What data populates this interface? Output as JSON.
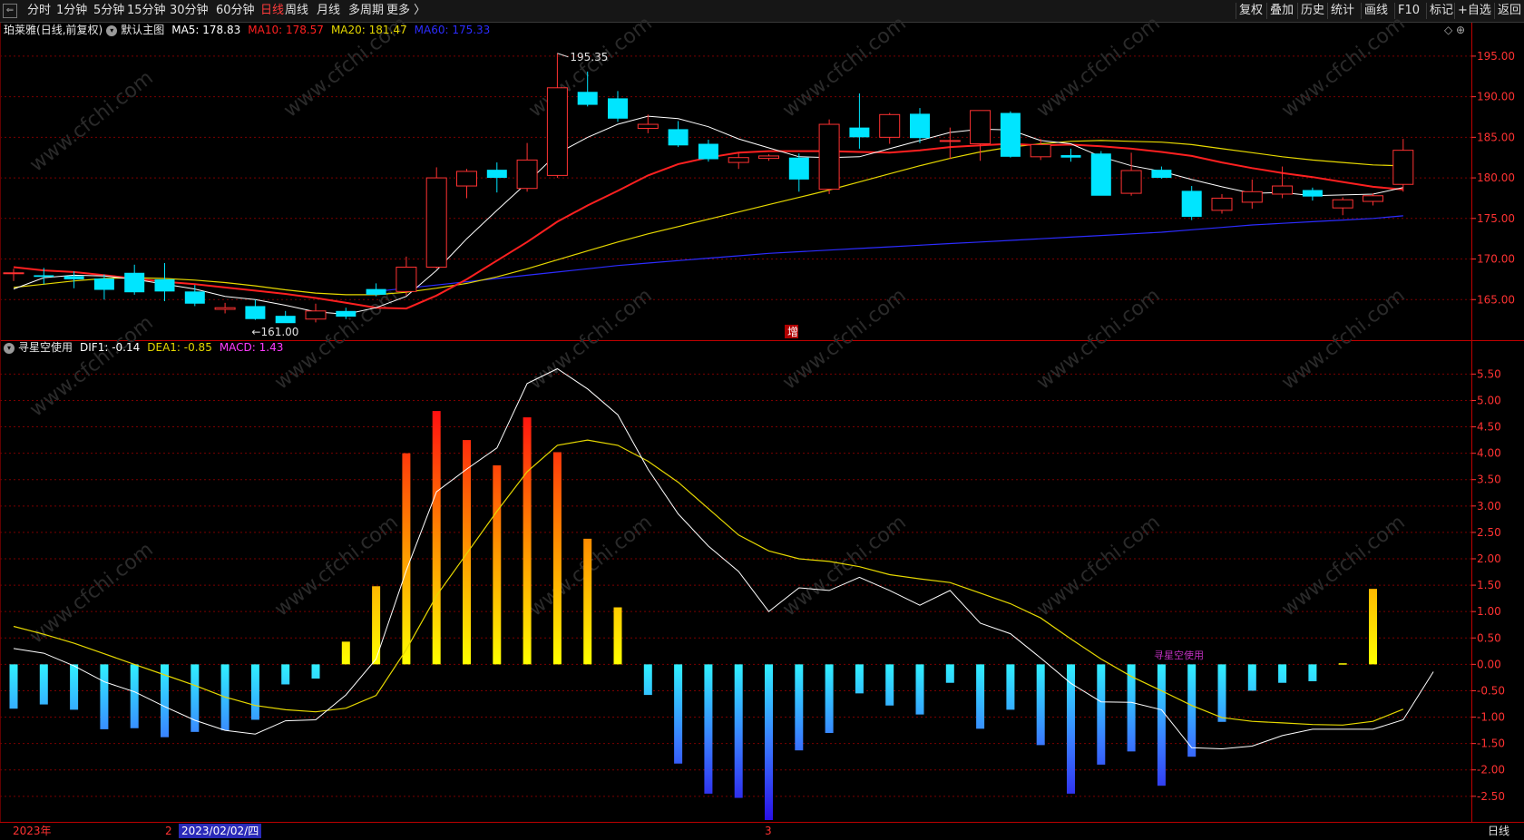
{
  "toolbar": {
    "back_glyph": "⇐",
    "timeframes": [
      {
        "label": "分时",
        "active": false
      },
      {
        "label": "1分钟",
        "active": false
      },
      {
        "label": "5分钟",
        "active": false
      },
      {
        "label": "15分钟",
        "active": false
      },
      {
        "label": "30分钟",
        "active": false
      },
      {
        "label": "60分钟",
        "active": false
      },
      {
        "label": "日线",
        "active": true
      },
      {
        "label": "周线",
        "active": false
      },
      {
        "label": "月线",
        "active": false
      },
      {
        "label": "多周期",
        "active": false
      },
      {
        "label": "更多 〉",
        "active": false
      }
    ],
    "right_buttons": [
      "复权",
      "叠加",
      "历史",
      "统计",
      "画线",
      "F10",
      "标记",
      "+自选",
      "返回"
    ]
  },
  "main_legend": {
    "name": "珀莱雅",
    "period": "(日线,前复权)",
    "template": "默认主图",
    "ma5": {
      "label": "MA5: 178.83",
      "color": "#ffffff"
    },
    "ma10": {
      "label": "MA10: 178.57",
      "color": "#ff2020"
    },
    "ma20": {
      "label": "MA20: 181.47",
      "color": "#e6d800"
    },
    "ma60": {
      "label": "MA60: 175.33",
      "color": "#2c2cff"
    }
  },
  "main_corner_icons": "◇ ⊕",
  "marker_zeng": "增",
  "main_axis": {
    "ticks": [
      "195.00",
      "190.00",
      "185.00",
      "180.00",
      "175.00",
      "170.00",
      "165.00"
    ],
    "min": 160.0,
    "max": 197.0
  },
  "annotations": {
    "high": "195.35",
    "low": "161.00"
  },
  "sub_legend": {
    "name": "寻星空使用",
    "dif": {
      "label": "DIF1: -0.14",
      "color": "#ffffff"
    },
    "dea": {
      "label": "DEA1: -0.85",
      "color": "#e6d800"
    },
    "macd": {
      "label": "MACD: 1.43",
      "color": "#ff3cff"
    }
  },
  "sub_axis": {
    "ticks": [
      "5.50",
      "5.00",
      "4.50",
      "4.00",
      "3.50",
      "3.00",
      "2.50",
      "2.00",
      "1.50",
      "1.00",
      "0.50",
      "0.00",
      "-0.50",
      "-1.00",
      "-1.50",
      "-2.00",
      "-2.50"
    ],
    "min": -2.95,
    "max": 5.85
  },
  "watermark_label": "寻星空使用",
  "watermark_site": "www.cfchi.com",
  "bottom": {
    "year": "2023年",
    "feb_mark": "2",
    "date": "2023/02/02/四",
    "mar_mark": "3",
    "period": "日线"
  },
  "colors": {
    "up": "#ff3232",
    "down": "#00e5ff",
    "grid": "#7a0000",
    "axis": "#ff3232"
  },
  "chart_data": {
    "type": "candlestick",
    "candles": [
      {
        "o": 168.2,
        "h": 168.8,
        "l": 167.3,
        "c": 168.3
      },
      {
        "o": 168.0,
        "h": 168.9,
        "l": 166.9,
        "c": 167.8
      },
      {
        "o": 167.9,
        "h": 168.5,
        "l": 166.4,
        "c": 167.5
      },
      {
        "o": 167.6,
        "h": 168.1,
        "l": 165.0,
        "c": 166.2
      },
      {
        "o": 168.3,
        "h": 169.3,
        "l": 165.6,
        "c": 165.9
      },
      {
        "o": 167.5,
        "h": 169.5,
        "l": 164.8,
        "c": 166.0
      },
      {
        "o": 166.0,
        "h": 166.8,
        "l": 164.2,
        "c": 164.5
      },
      {
        "o": 163.8,
        "h": 164.6,
        "l": 163.3,
        "c": 164.0
      },
      {
        "o": 164.2,
        "h": 165.0,
        "l": 162.5,
        "c": 162.6
      },
      {
        "o": 163.0,
        "h": 163.6,
        "l": 162.2,
        "c": 162.1
      },
      {
        "o": 162.6,
        "h": 164.5,
        "l": 162.2,
        "c": 163.6
      },
      {
        "o": 163.6,
        "h": 164.0,
        "l": 162.6,
        "c": 162.9
      },
      {
        "o": 166.3,
        "h": 167.0,
        "l": 165.4,
        "c": 165.6
      },
      {
        "o": 166.0,
        "h": 170.3,
        "l": 165.5,
        "c": 169.0
      },
      {
        "o": 169.0,
        "h": 181.3,
        "l": 168.8,
        "c": 180.0
      },
      {
        "o": 179.0,
        "h": 181.1,
        "l": 177.5,
        "c": 180.8
      },
      {
        "o": 181.0,
        "h": 181.9,
        "l": 178.2,
        "c": 180.0
      },
      {
        "o": 178.7,
        "h": 184.3,
        "l": 178.3,
        "c": 182.2
      },
      {
        "o": 180.3,
        "h": 195.35,
        "l": 180.0,
        "c": 191.1
      },
      {
        "o": 190.6,
        "h": 193.1,
        "l": 188.8,
        "c": 189.0
      },
      {
        "o": 189.8,
        "h": 190.7,
        "l": 186.9,
        "c": 187.3
      },
      {
        "o": 186.1,
        "h": 187.8,
        "l": 185.5,
        "c": 186.6
      },
      {
        "o": 186.0,
        "h": 187.0,
        "l": 183.8,
        "c": 184.0
      },
      {
        "o": 184.2,
        "h": 184.7,
        "l": 182.0,
        "c": 182.3
      },
      {
        "o": 181.9,
        "h": 183.1,
        "l": 181.1,
        "c": 182.5
      },
      {
        "o": 182.4,
        "h": 182.9,
        "l": 182.1,
        "c": 182.7
      },
      {
        "o": 182.5,
        "h": 183.0,
        "l": 178.3,
        "c": 179.8
      },
      {
        "o": 178.6,
        "h": 187.2,
        "l": 178.0,
        "c": 186.6
      },
      {
        "o": 186.2,
        "h": 190.4,
        "l": 183.6,
        "c": 185.0
      },
      {
        "o": 185.0,
        "h": 188.0,
        "l": 184.2,
        "c": 187.8
      },
      {
        "o": 187.9,
        "h": 188.6,
        "l": 184.3,
        "c": 184.9
      },
      {
        "o": 184.5,
        "h": 186.2,
        "l": 182.3,
        "c": 184.6
      },
      {
        "o": 184.2,
        "h": 188.3,
        "l": 182.1,
        "c": 188.3
      },
      {
        "o": 188.0,
        "h": 188.2,
        "l": 182.5,
        "c": 182.6
      },
      {
        "o": 182.6,
        "h": 184.8,
        "l": 182.2,
        "c": 184.1
      },
      {
        "o": 182.8,
        "h": 183.6,
        "l": 182.0,
        "c": 182.5
      },
      {
        "o": 183.0,
        "h": 183.3,
        "l": 179.0,
        "c": 177.8
      },
      {
        "o": 178.1,
        "h": 183.1,
        "l": 177.8,
        "c": 180.9
      },
      {
        "o": 181.0,
        "h": 181.4,
        "l": 179.9,
        "c": 180.0
      },
      {
        "o": 178.4,
        "h": 179.0,
        "l": 174.8,
        "c": 175.2
      },
      {
        "o": 176.0,
        "h": 178.0,
        "l": 175.6,
        "c": 177.5
      },
      {
        "o": 177.0,
        "h": 179.8,
        "l": 176.2,
        "c": 178.3
      },
      {
        "o": 178.0,
        "h": 181.4,
        "l": 177.5,
        "c": 179.0
      },
      {
        "o": 178.5,
        "h": 178.8,
        "l": 177.2,
        "c": 177.7
      },
      {
        "o": 176.3,
        "h": 177.6,
        "l": 175.4,
        "c": 177.3
      },
      {
        "o": 177.1,
        "h": 178.1,
        "l": 176.6,
        "c": 177.8
      },
      {
        "o": 179.2,
        "h": 184.8,
        "l": 178.3,
        "c": 183.4
      }
    ],
    "ma5": [
      166.3,
      167.7,
      168.0,
      167.9,
      167.5,
      166.9,
      166.3,
      165.4,
      165.0,
      164.3,
      163.5,
      163.2,
      164.0,
      165.4,
      168.6,
      172.5,
      176.0,
      179.4,
      183.0,
      185.0,
      186.6,
      187.6,
      187.3,
      186.3,
      184.8,
      183.7,
      182.6,
      182.5,
      182.6,
      183.6,
      184.6,
      185.6,
      186.0,
      185.9,
      184.6,
      184.2,
      182.6,
      181.5,
      180.8,
      179.8,
      178.9,
      178.1,
      178.2,
      177.8,
      177.9,
      178.0,
      178.8
    ],
    "ma10": [
      169.0,
      168.6,
      168.4,
      168.0,
      167.6,
      167.2,
      166.9,
      166.5,
      166.1,
      165.7,
      165.2,
      164.6,
      164.0,
      163.9,
      165.5,
      167.5,
      169.8,
      172.1,
      174.6,
      176.6,
      178.4,
      180.3,
      181.7,
      182.5,
      183.1,
      183.3,
      183.3,
      183.3,
      183.2,
      183.1,
      183.4,
      183.8,
      184.0,
      184.2,
      184.0,
      184.1,
      183.9,
      183.6,
      183.2,
      182.7,
      181.9,
      181.2,
      180.6,
      180.1,
      179.5,
      178.9,
      178.57
    ],
    "ma20": [
      166.5,
      166.9,
      167.3,
      167.6,
      167.7,
      167.6,
      167.4,
      167.1,
      166.7,
      166.2,
      165.8,
      165.6,
      165.6,
      165.9,
      166.4,
      167.0,
      167.8,
      168.8,
      169.9,
      171.0,
      172.1,
      173.1,
      174.0,
      174.9,
      175.8,
      176.7,
      177.6,
      178.5,
      179.5,
      180.5,
      181.5,
      182.4,
      183.2,
      183.8,
      184.2,
      184.5,
      184.6,
      184.5,
      184.4,
      184.1,
      183.6,
      183.1,
      182.6,
      182.2,
      181.9,
      181.6,
      181.47
    ],
    "ma60": [
      null,
      null,
      null,
      null,
      null,
      null,
      null,
      null,
      null,
      null,
      null,
      null,
      166.0,
      166.4,
      166.8,
      167.2,
      167.6,
      168.0,
      168.4,
      168.8,
      169.2,
      169.5,
      169.8,
      170.1,
      170.4,
      170.7,
      170.9,
      171.1,
      171.3,
      171.5,
      171.7,
      171.9,
      172.1,
      172.3,
      172.5,
      172.7,
      172.9,
      173.1,
      173.3,
      173.6,
      173.9,
      174.2,
      174.4,
      174.6,
      174.8,
      175.0,
      175.33
    ],
    "dif": [
      0.3,
      0.21,
      -0.03,
      -0.33,
      -0.52,
      -0.8,
      -1.06,
      -1.25,
      -1.32,
      -1.07,
      -1.05,
      -0.58,
      0.1,
      1.78,
      3.27,
      3.7,
      4.1,
      5.32,
      5.6,
      5.22,
      4.73,
      3.7,
      2.85,
      2.24,
      1.76,
      1.0,
      1.45,
      1.4,
      1.65,
      1.4,
      1.12,
      1.4,
      0.78,
      0.58,
      0.12,
      -0.36,
      -0.71,
      -0.72,
      -0.86,
      -1.58,
      -1.6,
      -1.55,
      -1.35,
      -1.23,
      -1.23,
      -1.23,
      -1.05,
      -0.14
    ],
    "dea": [
      0.72,
      0.57,
      0.4,
      0.2,
      0.0,
      -0.2,
      -0.4,
      -0.62,
      -0.78,
      -0.86,
      -0.9,
      -0.83,
      -0.59,
      0.28,
      1.3,
      2.1,
      2.9,
      3.65,
      4.15,
      4.25,
      4.15,
      3.85,
      3.45,
      2.95,
      2.45,
      2.15,
      2.0,
      1.95,
      1.85,
      1.7,
      1.62,
      1.55,
      1.35,
      1.15,
      0.88,
      0.48,
      0.1,
      -0.23,
      -0.5,
      -0.78,
      -1.01,
      -1.08,
      -1.11,
      -1.14,
      -1.15,
      -1.08,
      -0.85
    ],
    "macd": [
      -0.84,
      -0.76,
      -0.86,
      -1.23,
      -1.21,
      -1.38,
      -1.28,
      -1.25,
      -1.05,
      -0.38,
      -0.27,
      0.43,
      1.48,
      4.0,
      4.8,
      4.25,
      3.77,
      4.68,
      4.02,
      2.38,
      1.08,
      -0.58,
      -1.88,
      -2.45,
      -2.53,
      -2.95,
      -1.63,
      -1.3,
      -0.55,
      -0.78,
      -0.95,
      -0.35,
      -1.22,
      -0.86,
      -1.53,
      -2.45,
      -1.9,
      -1.65,
      -2.3,
      -1.75,
      -1.09,
      -0.5,
      -0.35,
      -0.32,
      0.02,
      1.43
    ]
  }
}
